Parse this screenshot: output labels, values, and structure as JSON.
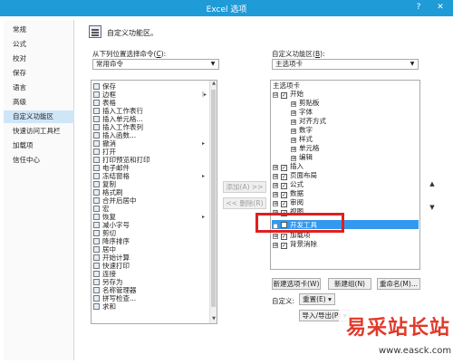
{
  "window": {
    "title": "Excel 选项",
    "help": "?",
    "close": "✕"
  },
  "sidebar": {
    "items": [
      {
        "label": "常规"
      },
      {
        "label": "公式"
      },
      {
        "label": "校对"
      },
      {
        "label": "保存"
      },
      {
        "label": "语言"
      },
      {
        "label": "高级"
      },
      {
        "label": "自定义功能区"
      },
      {
        "label": "快速访问工具栏"
      },
      {
        "label": "加载项"
      },
      {
        "label": "信任中心"
      }
    ],
    "active_index": 6
  },
  "header": {
    "text": "自定义功能区。"
  },
  "left": {
    "label_prefix": "从下列位置选择命令(",
    "label_key": "C",
    "label_suffix": "):",
    "combo_value": "常用命令",
    "commands": [
      {
        "label": "保存"
      },
      {
        "label": "边框",
        "sub": "|▸"
      },
      {
        "label": "表格"
      },
      {
        "label": "插入工作表行"
      },
      {
        "label": "插入单元格..."
      },
      {
        "label": "插入工作表列"
      },
      {
        "label": "插入函数..."
      },
      {
        "label": "撤消",
        "sub": "▸"
      },
      {
        "label": "打开"
      },
      {
        "label": "打印预览和打印"
      },
      {
        "label": "电子邮件"
      },
      {
        "label": "冻结窗格",
        "sub": "▸"
      },
      {
        "label": "复制"
      },
      {
        "label": "格式刷"
      },
      {
        "label": "合并后居中"
      },
      {
        "label": "宏"
      },
      {
        "label": "恢复",
        "sub": "▸"
      },
      {
        "label": "减小字号"
      },
      {
        "label": "剪切"
      },
      {
        "label": "降序排序"
      },
      {
        "label": "居中"
      },
      {
        "label": "开始计算"
      },
      {
        "label": "快速打印"
      },
      {
        "label": "连接"
      },
      {
        "label": "另存为"
      },
      {
        "label": "名称管理器"
      },
      {
        "label": "拼写检查..."
      },
      {
        "label": "求和"
      }
    ]
  },
  "middle": {
    "add": "添加(A) >>",
    "remove": "<< 删除(R)"
  },
  "right": {
    "label_prefix": "自定义功能区(",
    "label_key": "B",
    "label_suffix": "):",
    "combo_value": "主选项卡",
    "tree": [
      {
        "label": "主选项卡",
        "level": 0,
        "expander": "",
        "checkbox": ""
      },
      {
        "label": "开始",
        "level": 0,
        "expander": "⊟",
        "checkbox": "✓"
      },
      {
        "label": "剪贴板",
        "level": 1,
        "expander": "⊞",
        "checkbox": ""
      },
      {
        "label": "字体",
        "level": 1,
        "expander": "⊞",
        "checkbox": ""
      },
      {
        "label": "对齐方式",
        "level": 1,
        "expander": "⊞",
        "checkbox": ""
      },
      {
        "label": "数字",
        "level": 1,
        "expander": "⊞",
        "checkbox": ""
      },
      {
        "label": "样式",
        "level": 1,
        "expander": "⊞",
        "checkbox": ""
      },
      {
        "label": "单元格",
        "level": 1,
        "expander": "⊞",
        "checkbox": ""
      },
      {
        "label": "编辑",
        "level": 1,
        "expander": "⊞",
        "checkbox": ""
      },
      {
        "label": "插入",
        "level": 0,
        "expander": "⊞",
        "checkbox": "✓"
      },
      {
        "label": "页面布局",
        "level": 0,
        "expander": "⊞",
        "checkbox": "✓"
      },
      {
        "label": "公式",
        "level": 0,
        "expander": "⊞",
        "checkbox": "✓"
      },
      {
        "label": "数据",
        "level": 0,
        "expander": "⊞",
        "checkbox": "✓"
      },
      {
        "label": "审阅",
        "level": 0,
        "expander": "⊞",
        "checkbox": "✓"
      },
      {
        "label": "视图",
        "level": 0,
        "expander": "⊞",
        "checkbox": "✓"
      },
      {
        "label": "开发工具",
        "level": 0,
        "expander": "⊞",
        "checkbox": "",
        "selected": true
      },
      {
        "label": "加载项",
        "level": 0,
        "expander": "⊞",
        "checkbox": "✓"
      },
      {
        "label": "背景消除",
        "level": 0,
        "expander": "⊞",
        "checkbox": "✓"
      }
    ],
    "new_tab": "新建选项卡(W)",
    "new_group": "新建组(N)",
    "rename": "重命名(M)...",
    "customize_label": "自定义:",
    "reset": "重置(E) ▾",
    "import_export": "导入/导出(P) ▾"
  },
  "watermark": {
    "text": "易采站长站",
    "url": "www.easck.com"
  },
  "colors": {
    "titlebar": "#1f9bd8",
    "active_sidebar": "#cfe6f7",
    "selection": "#3399ee",
    "highlight_box": "#e02020"
  }
}
